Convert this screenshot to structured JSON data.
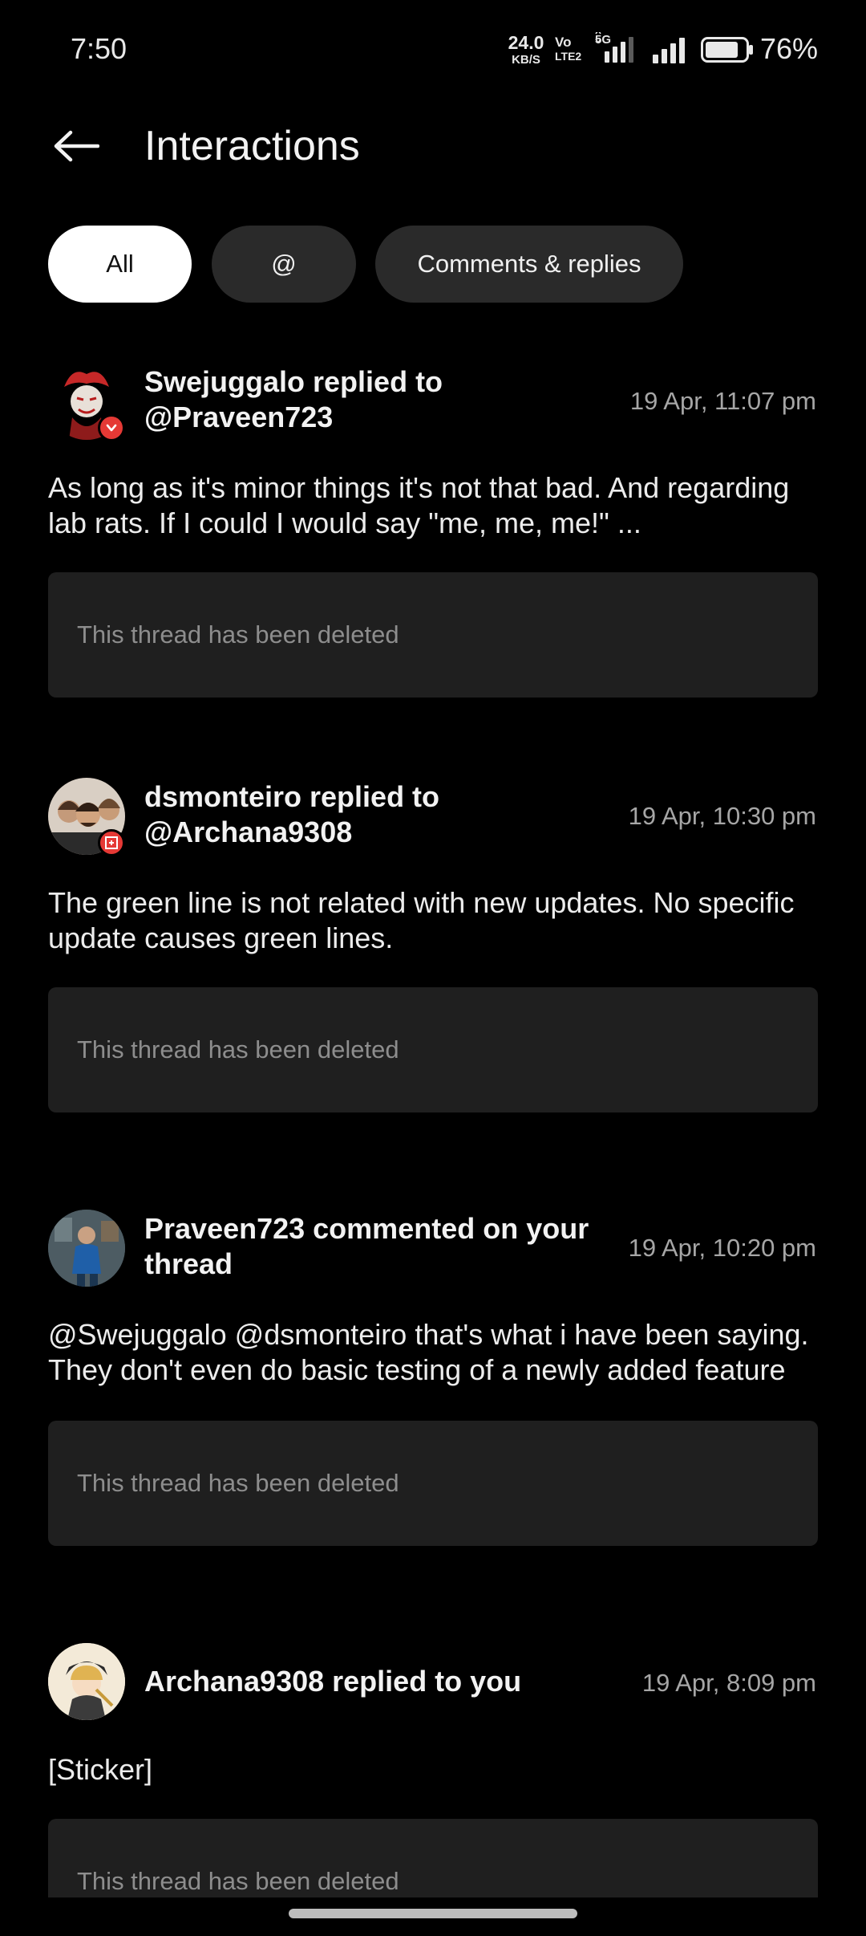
{
  "status_bar": {
    "time": "7:50",
    "net_speed_value": "24.0",
    "net_speed_unit": "KB/S",
    "volte_top": "Vo",
    "volte_bottom": "LTE2",
    "network_type": "5G",
    "battery_pct": "76%",
    "icons": [
      "signal-5g-icon",
      "signal-icon",
      "battery-icon"
    ]
  },
  "header": {
    "title": "Interactions",
    "back_icon": "arrow-left-icon"
  },
  "filters": {
    "tabs": [
      {
        "label": "All",
        "active": true
      },
      {
        "label": "@",
        "active": false
      },
      {
        "label": "Comments & replies",
        "active": false
      }
    ]
  },
  "feed": {
    "items": [
      {
        "header": "Swejuggalo replied to @Praveen723",
        "time": "19 Apr, 11:07 pm",
        "body": "As long as it's minor things it's not that bad. And regarding lab rats. If I could I would say \"me, me, me!\" ...",
        "deleted": "This thread has been deleted",
        "avatar": "jester-avatar",
        "badge": "verified-badge-icon"
      },
      {
        "header": "dsmonteiro replied to @Archana9308",
        "time": "19 Apr, 10:30 pm",
        "body": "The green line is not related with new updates. No specific update causes green lines.",
        "deleted": "This thread has been deleted",
        "avatar": "group-photo-avatar",
        "badge": "oneplus-badge-icon"
      },
      {
        "header": "Praveen723 commented on your thread",
        "time": "19 Apr, 10:20 pm",
        "body": "@Swejuggalo @dsmonteiro that's what i have been saying. They don't even do basic testing of a newly added feature",
        "deleted": "This thread has been deleted",
        "avatar": "figure-avatar"
      },
      {
        "header": "Archana9308 replied to you",
        "time": "19 Apr, 8:09 pm",
        "body": "[Sticker]",
        "deleted": "This thread has been deleted",
        "avatar": "cartoon-avatar"
      }
    ]
  },
  "colors": {
    "background": "#000000",
    "chip_active_bg": "#ffffff",
    "chip_inactive_bg": "#2a2a2a",
    "card_bg": "#1f1f1f",
    "timestamp": "#a6a6a6",
    "badge_red": "#e53935"
  }
}
